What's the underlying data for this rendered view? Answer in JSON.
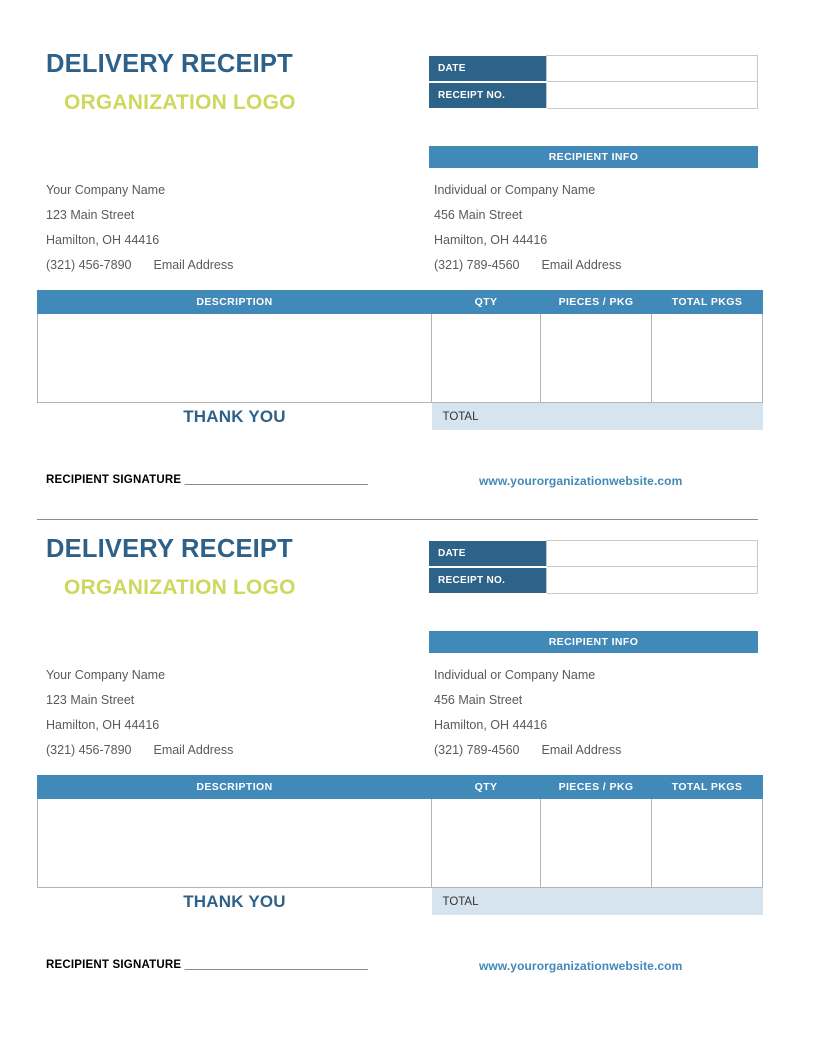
{
  "document": {
    "title": "DELIVERY RECEIPT",
    "logo_text": "ORGANIZATION LOGO"
  },
  "meta": {
    "date_label": "DATE",
    "date_value": "",
    "receipt_no_label": "RECEIPT NO.",
    "receipt_no_value": ""
  },
  "sender": {
    "company": "Your Company Name",
    "street": "123 Main Street",
    "city_state_zip": "Hamilton, OH  44416",
    "phone": "(321) 456-7890",
    "email": "Email Address"
  },
  "recipient": {
    "section_title": "RECIPIENT INFO",
    "company": "Individual or Company Name",
    "street": "456 Main Street",
    "city_state_zip": "Hamilton, OH  44416",
    "phone": "(321) 789-4560",
    "email": "Email Address"
  },
  "items_table": {
    "columns": [
      "DESCRIPTION",
      "QTY",
      "PIECES / PKG",
      "TOTAL PKGS"
    ],
    "rows": [
      {
        "description": "",
        "qty": "",
        "pieces_per_pkg": "",
        "total_pkgs": ""
      }
    ],
    "thank_you": "THANK YOU",
    "total_label": "TOTAL",
    "total_value": ""
  },
  "footer": {
    "signature_label": "RECIPIENT SIGNATURE",
    "signature_rule": "_______________________________",
    "website": "www.yourorganizationwebsite.com"
  },
  "colors": {
    "title_blue": "#2e6189",
    "header_blue": "#4189b8",
    "dark_blue": "#2e6389",
    "logo_green": "#ccd95f",
    "total_fill": "#d6e4ef"
  }
}
